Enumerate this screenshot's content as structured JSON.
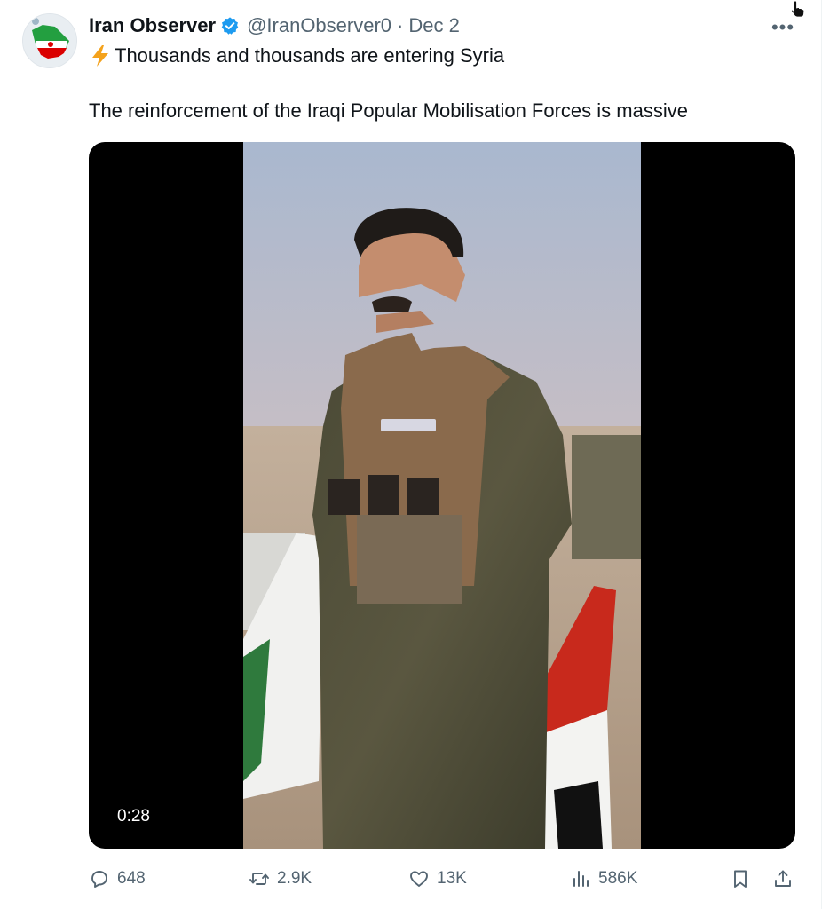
{
  "tweet": {
    "author_name": "Iran Observer",
    "handle": "@IranObserver0",
    "separator": "·",
    "date": "Dec 2",
    "line1": "Thousands and thousands are entering Syria",
    "line2": "The reinforcement of the Iraqi Popular Mobilisation Forces is massive",
    "more_label": "•••"
  },
  "media": {
    "duration": "0:28"
  },
  "actions": {
    "replies": "648",
    "reposts": "2.9K",
    "likes": "13K",
    "views": "586K"
  },
  "colors": {
    "accent": "#1d9bf0",
    "muted": "#536471",
    "text": "#0f1419"
  },
  "icons": [
    "verified-badge-icon",
    "lightning-icon",
    "more-icon",
    "reply-icon",
    "repost-icon",
    "like-icon",
    "views-icon",
    "bookmark-icon",
    "share-icon"
  ]
}
